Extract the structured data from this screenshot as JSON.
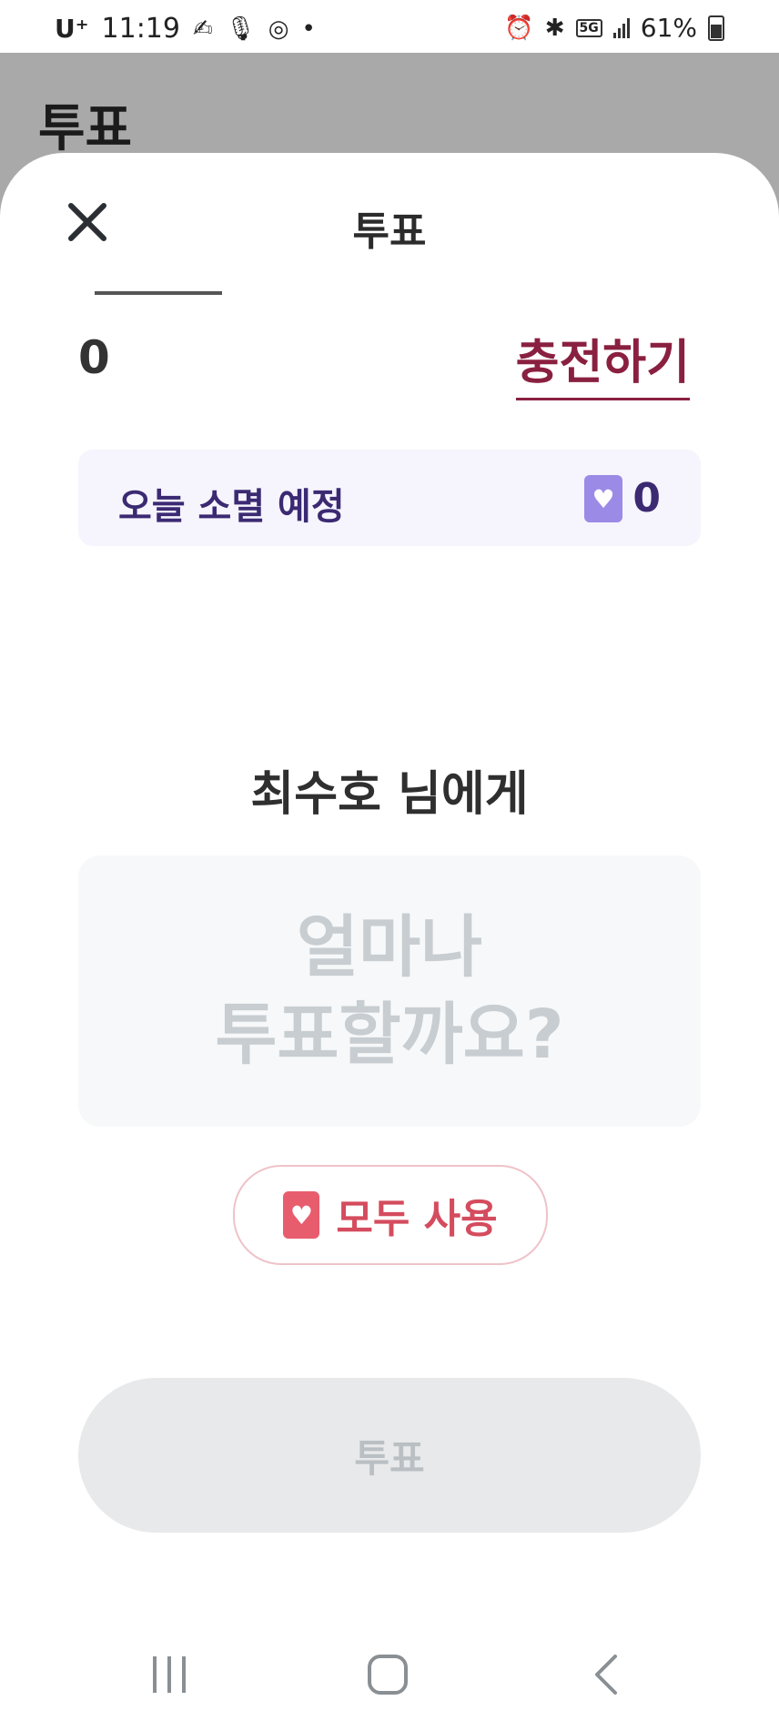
{
  "status_bar": {
    "carrier": "U⁺",
    "time": "11:19",
    "network": "5G",
    "battery": "61%"
  },
  "background_page": {
    "title": "투표"
  },
  "sheet": {
    "title": "투표",
    "balance": "0",
    "charge_label": "충전하기",
    "expiring": {
      "label": "오늘 소멸 예정",
      "count": "0"
    },
    "recipient": "최수호 님에게",
    "amount_placeholder": "얼마나\n투표할까요?",
    "use_all_label": "모두 사용",
    "vote_label": "투표"
  },
  "colors": {
    "accent_wine": "#8a2040",
    "expire_text": "#3b2a72",
    "heart_purple": "#9b8ae6",
    "heart_red": "#e85d6d",
    "use_all_text": "#d44c5e"
  }
}
